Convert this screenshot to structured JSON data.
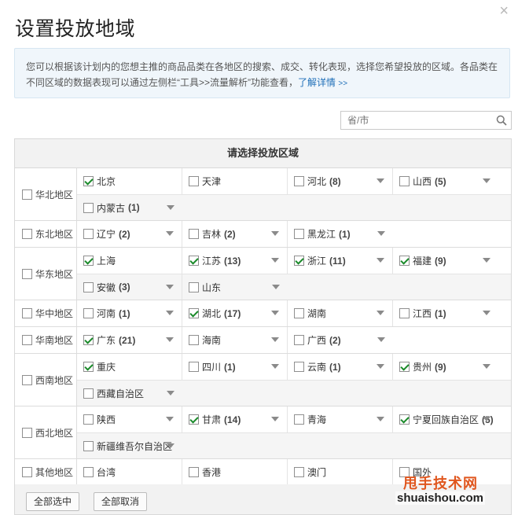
{
  "dialog": {
    "title": "设置投放地域",
    "close_glyph": "×",
    "notice": "您可以根据该计划内的您想主推的商品品类在各地区的搜索、成交、转化表现，选择您希望投放的区域。各品类在不同区域的数据表现可以通过左侧栏“工具>>流量解析”功能查看，",
    "notice_link": "了解详情",
    "notice_link_arrow": ">>"
  },
  "search": {
    "placeholder": "省/市",
    "icon": "search-icon"
  },
  "table": {
    "header": "请选择投放区域",
    "regions": [
      {
        "name": "华北地区",
        "checked": false,
        "lines": [
          [
            {
              "name": "北京",
              "checked": true
            },
            {
              "name": "天津",
              "checked": false
            },
            {
              "name": "河北",
              "count": "(8)",
              "checked": false,
              "dropdown": true
            },
            {
              "name": "山西",
              "count": "(5)",
              "checked": false,
              "dropdown": true
            }
          ],
          [
            {
              "name": "内蒙古",
              "count": "(1)",
              "checked": false,
              "dropdown": true
            }
          ]
        ]
      },
      {
        "name": "东北地区",
        "checked": false,
        "lines": [
          [
            {
              "name": "辽宁",
              "count": "(2)",
              "checked": false,
              "dropdown": true
            },
            {
              "name": "吉林",
              "count": "(2)",
              "checked": false,
              "dropdown": true
            },
            {
              "name": "黑龙江",
              "count": "(1)",
              "checked": false,
              "dropdown": true
            }
          ]
        ]
      },
      {
        "name": "华东地区",
        "checked": false,
        "lines": [
          [
            {
              "name": "上海",
              "checked": true
            },
            {
              "name": "江苏",
              "count": "(13)",
              "checked": true,
              "dropdown": true
            },
            {
              "name": "浙江",
              "count": "(11)",
              "checked": true,
              "dropdown": true
            },
            {
              "name": "福建",
              "count": "(9)",
              "checked": true,
              "dropdown": true
            }
          ],
          [
            {
              "name": "安徽",
              "count": "(3)",
              "checked": false,
              "dropdown": true
            },
            {
              "name": "山东",
              "checked": false,
              "dropdown": true
            }
          ]
        ]
      },
      {
        "name": "华中地区",
        "checked": false,
        "lines": [
          [
            {
              "name": "河南",
              "count": "(1)",
              "checked": false,
              "dropdown": true
            },
            {
              "name": "湖北",
              "count": "(17)",
              "checked": true,
              "dropdown": true
            },
            {
              "name": "湖南",
              "checked": false,
              "dropdown": true
            },
            {
              "name": "江西",
              "count": "(1)",
              "checked": false,
              "dropdown": true
            }
          ]
        ]
      },
      {
        "name": "华南地区",
        "checked": false,
        "lines": [
          [
            {
              "name": "广东",
              "count": "(21)",
              "checked": true,
              "dropdown": true
            },
            {
              "name": "海南",
              "checked": false,
              "dropdown": true
            },
            {
              "name": "广西",
              "count": "(2)",
              "checked": false,
              "dropdown": true
            }
          ]
        ]
      },
      {
        "name": "西南地区",
        "checked": false,
        "lines": [
          [
            {
              "name": "重庆",
              "checked": true
            },
            {
              "name": "四川",
              "count": "(1)",
              "checked": false,
              "dropdown": true
            },
            {
              "name": "云南",
              "count": "(1)",
              "checked": false,
              "dropdown": true
            },
            {
              "name": "贵州",
              "count": "(9)",
              "checked": true,
              "dropdown": true
            }
          ],
          [
            {
              "name": "西藏自治区",
              "checked": false,
              "dropdown": true
            }
          ]
        ]
      },
      {
        "name": "西北地区",
        "checked": false,
        "lines": [
          [
            {
              "name": "陕西",
              "checked": false,
              "dropdown": true
            },
            {
              "name": "甘肃",
              "count": "(14)",
              "checked": true,
              "dropdown": true
            },
            {
              "name": "青海",
              "checked": false,
              "dropdown": true
            },
            {
              "name": "宁夏回族自治区",
              "count": "(5)",
              "checked": true,
              "dropdown": true
            }
          ],
          [
            {
              "name": "新疆维吾尔自治区",
              "checked": false,
              "dropdown": true
            }
          ]
        ]
      },
      {
        "name": "其他地区",
        "checked": false,
        "lines": [
          [
            {
              "name": "台湾",
              "checked": false
            },
            {
              "name": "香港",
              "checked": false
            },
            {
              "name": "澳门",
              "checked": false
            },
            {
              "name": "国外",
              "checked": false
            }
          ]
        ]
      }
    ]
  },
  "footer": {
    "select_all": "全部选中",
    "deselect_all": "全部取消"
  },
  "watermark": {
    "line1": "甩手技术网",
    "line2": "shuaishou.com"
  },
  "colors": {
    "link": "#1f6fb8",
    "check": "#1a8a2a",
    "header_bg": "#f2f2f2",
    "notice_bg": "#f0f6fb"
  }
}
